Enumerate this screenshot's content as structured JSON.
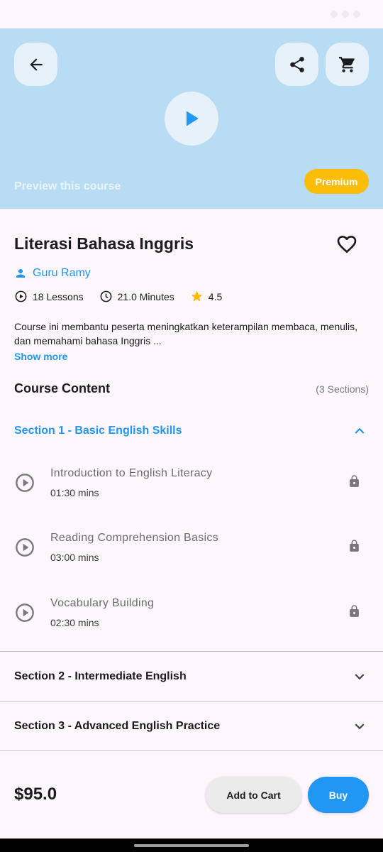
{
  "hero": {
    "preview_label": "Preview this course",
    "badge": "Premium"
  },
  "course": {
    "title": "Literasi Bahasa Inggris",
    "teacher": "Guru Ramy",
    "lessons": "18 Lessons",
    "minutes": "21.0 Minutes",
    "rating": "4.5",
    "description": "Course ini membantu peserta meningkatkan keterampilan membaca, menulis, dan memahami bahasa Inggris ...",
    "show_more": "Show more"
  },
  "content": {
    "title": "Course Content",
    "count": "(3 Sections)",
    "sections": [
      {
        "label": "Section 1 - Basic English Skills",
        "lessons": [
          {
            "title": "Introduction to English Literacy",
            "duration": "01:30 mins"
          },
          {
            "title": "Reading Comprehension Basics",
            "duration": "03:00 mins"
          },
          {
            "title": "Vocabulary Building",
            "duration": "02:30 mins"
          }
        ]
      },
      {
        "label": "Section 2 - Intermediate English"
      },
      {
        "label": "Section 3 - Advanced English Practice"
      }
    ]
  },
  "footer": {
    "price": "$95.0",
    "add_to_cart": "Add to Cart",
    "buy": "Buy"
  },
  "colors": {
    "accent": "#2196f3",
    "hero_bg": "#b7dcf4",
    "premium": "#fbbd08",
    "star": "#fbbd08"
  },
  "icons": [
    "arrow-left-icon",
    "share-icon",
    "cart-icon",
    "play-icon",
    "heart-outline-icon",
    "person-icon",
    "play-circle-outline-icon",
    "clock-icon",
    "star-icon",
    "chevron-up-icon",
    "chevron-down-icon",
    "lock-icon"
  ]
}
